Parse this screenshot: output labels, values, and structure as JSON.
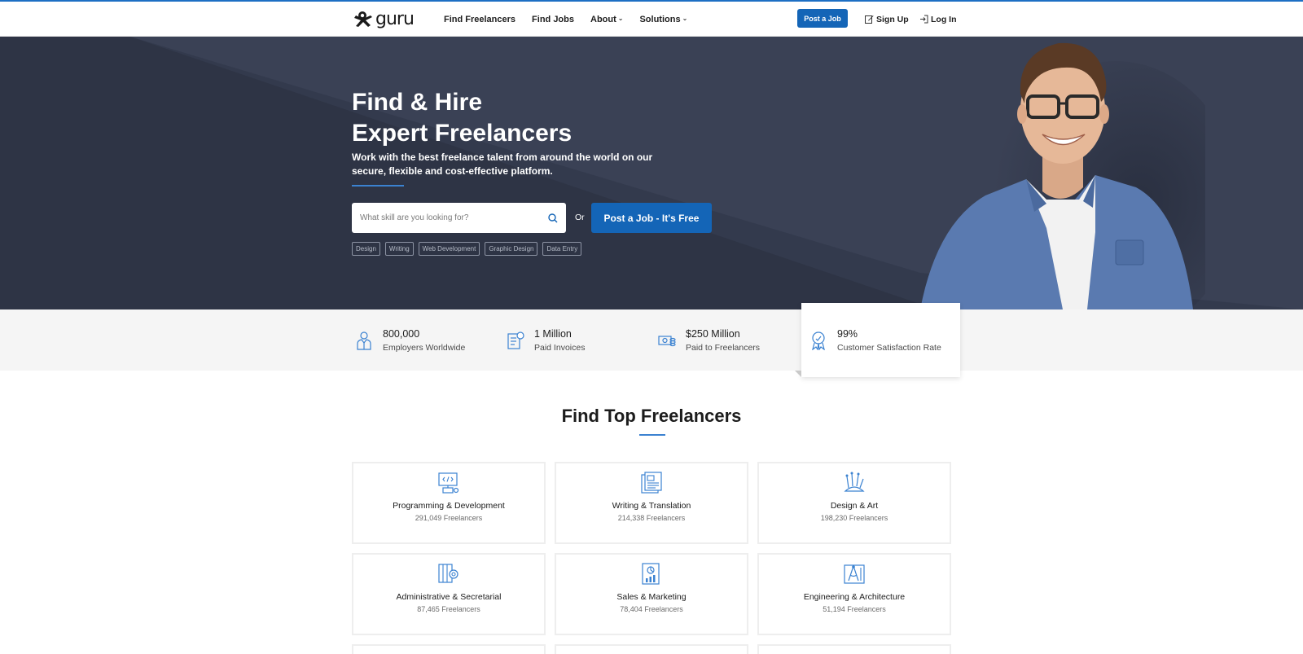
{
  "header": {
    "logo_text": "guru",
    "nav": [
      {
        "label": "Find Freelancers",
        "has_dropdown": false
      },
      {
        "label": "Find Jobs",
        "has_dropdown": false
      },
      {
        "label": "About",
        "has_dropdown": true
      },
      {
        "label": "Solutions",
        "has_dropdown": true
      }
    ],
    "post_job_label": "Post a Job",
    "sign_up_label": "Sign Up",
    "log_in_label": "Log In"
  },
  "hero": {
    "title_line1": "Find & Hire",
    "title_line2": "Expert Freelancers",
    "subtitle": "Work with the best freelance talent from around the world on our secure, flexible and cost-effective platform.",
    "search_placeholder": "What skill are you looking for?",
    "or_text": "Or",
    "post_button_label": "Post a Job - It's Free",
    "tags": [
      "Design",
      "Writing",
      "Web Development",
      "Graphic Design",
      "Data Entry"
    ]
  },
  "stats": [
    {
      "value": "800,000",
      "label": "Employers Worldwide",
      "icon": "employer-icon"
    },
    {
      "value": "1 Million",
      "label": "Paid Invoices",
      "icon": "invoice-icon"
    },
    {
      "value": "$250 Million",
      "label": "Paid to Freelancers",
      "icon": "money-icon"
    },
    {
      "value": "99%",
      "label": "Customer Satisfaction Rate",
      "icon": "award-icon"
    }
  ],
  "categories_section": {
    "title": "Find Top Freelancers",
    "cards": [
      {
        "name": "Programming & Development",
        "count": "291,049 Freelancers",
        "icon": "code-monitor-icon"
      },
      {
        "name": "Writing & Translation",
        "count": "214,338 Freelancers",
        "icon": "document-icon"
      },
      {
        "name": "Design & Art",
        "count": "198,230 Freelancers",
        "icon": "brushes-icon"
      },
      {
        "name": "Administrative & Secretarial",
        "count": "87,465 Freelancers",
        "icon": "admin-gear-icon"
      },
      {
        "name": "Sales & Marketing",
        "count": "78,404 Freelancers",
        "icon": "chart-report-icon"
      },
      {
        "name": "Engineering & Architecture",
        "count": "51,194 Freelancers",
        "icon": "compass-blueprint-icon"
      }
    ]
  },
  "colors": {
    "brand_blue": "#1465b7",
    "hero_bg": "#2e3445",
    "accent": "#3b82d1"
  }
}
